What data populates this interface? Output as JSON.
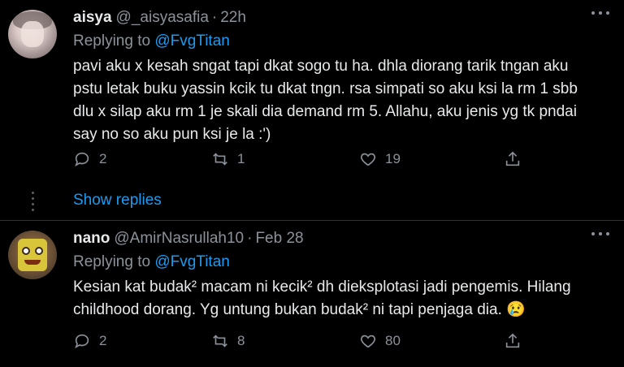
{
  "tweets": [
    {
      "name": "aisya",
      "handle": "@_aisyasafia",
      "time": "22h",
      "replying_label": "Replying to",
      "replying_to": "@FvgTitan",
      "text": "pavi aku x kesah sngat tapi dkat sogo tu ha. dhla diorang tarik tngan aku pstu letak buku yassin kcik tu dkat tngn. rsa simpati so aku ksi la rm 1 sbb dlu x silap aku rm 1 je skali dia demand rm 5. Allahu, aku jenis yg tk pndai say no so aku pun ksi je la :')",
      "replies": "2",
      "retweets": "1",
      "likes": "19"
    },
    {
      "name": "nano",
      "handle": "@AmirNasrullah10",
      "time": "Feb 28",
      "replying_label": "Replying to",
      "replying_to": "@FvgTitan",
      "text": "Kesian kat budak² macam ni kecik² dh dieksplotasi jadi pengemis. Hilang childhood dorang. Yg untung bukan budak² ni tapi penjaga dia. 😢",
      "replies": "2",
      "retweets": "8",
      "likes": "80"
    }
  ],
  "show_replies": "Show replies",
  "icons": [
    "reply-icon",
    "retweet-icon",
    "like-icon",
    "share-icon",
    "more-icon"
  ],
  "colors": {
    "background": "#000000",
    "accent": "#1d9bf0",
    "muted": "#8b9299",
    "text": "#e7e9ea"
  }
}
